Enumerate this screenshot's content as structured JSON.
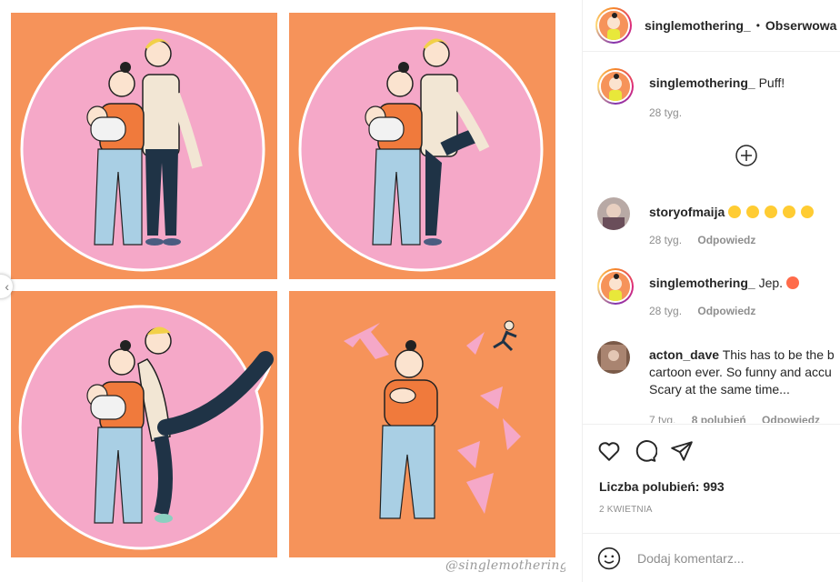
{
  "media": {
    "watermark": "@singlemothering_"
  },
  "header": {
    "username": "singlemothering_",
    "separator": "•",
    "follow_label": "Obserwowa"
  },
  "caption": {
    "username": "singlemothering_",
    "text": "Puff!",
    "time": "28 tyg."
  },
  "comments": [
    {
      "username": "storyofmaija",
      "text": "",
      "time": "28 tyg.",
      "reply_label": "Odpowiedz",
      "emoji_count": 5
    },
    {
      "username": "singlemothering_",
      "text": "Jep.",
      "time": "28 tyg.",
      "reply_label": "Odpowiedz"
    },
    {
      "username": "acton_dave",
      "text_line1": "This has to be the b",
      "text_line2": "cartoon ever. So funny and accu",
      "text_line3": "Scary at the same time...",
      "time": "7 tyg.",
      "likes": "8 polubień",
      "reply_label": "Odpowiedz"
    }
  ],
  "actions": {
    "likes_text": "Liczba polubień: 993",
    "date": "2 KWIETNIA"
  },
  "add_comment": {
    "placeholder": "Dodaj komentarz..."
  },
  "colors": {
    "panel_orange": "#f6935a",
    "circle_pink": "#f5a8c8",
    "jeans": "#a9cfe4",
    "shirt": "#f07a3c",
    "pants_dark": "#1f3346"
  },
  "icons": [
    "chevron-left-icon",
    "plus-circle-icon",
    "heart-icon",
    "comment-icon",
    "share-icon",
    "emoji-icon"
  ]
}
